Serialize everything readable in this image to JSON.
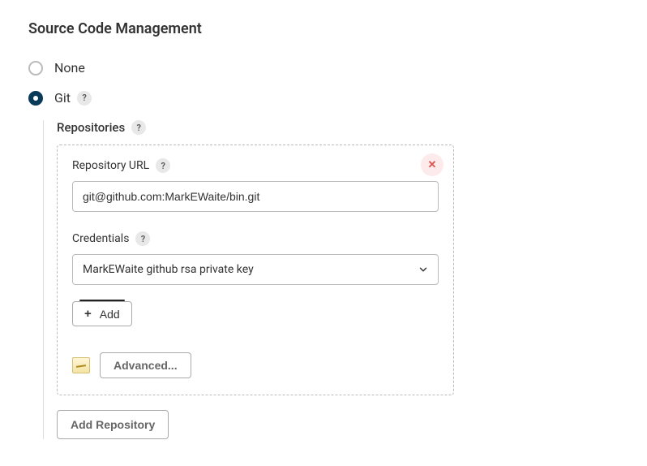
{
  "section": {
    "title": "Source Code Management"
  },
  "scm_options": {
    "none": {
      "label": "None"
    },
    "git": {
      "label": "Git"
    }
  },
  "repositories": {
    "header": "Repositories",
    "url": {
      "label": "Repository URL",
      "value": "git@github.com:MarkEWaite/bin.git"
    },
    "credentials": {
      "label": "Credentials",
      "selected": "MarkEWaite github rsa private key",
      "add_label": "Add"
    },
    "advanced_label": "Advanced...",
    "add_repository_label": "Add Repository"
  },
  "help_symbol": "?",
  "close_symbol": "✕"
}
